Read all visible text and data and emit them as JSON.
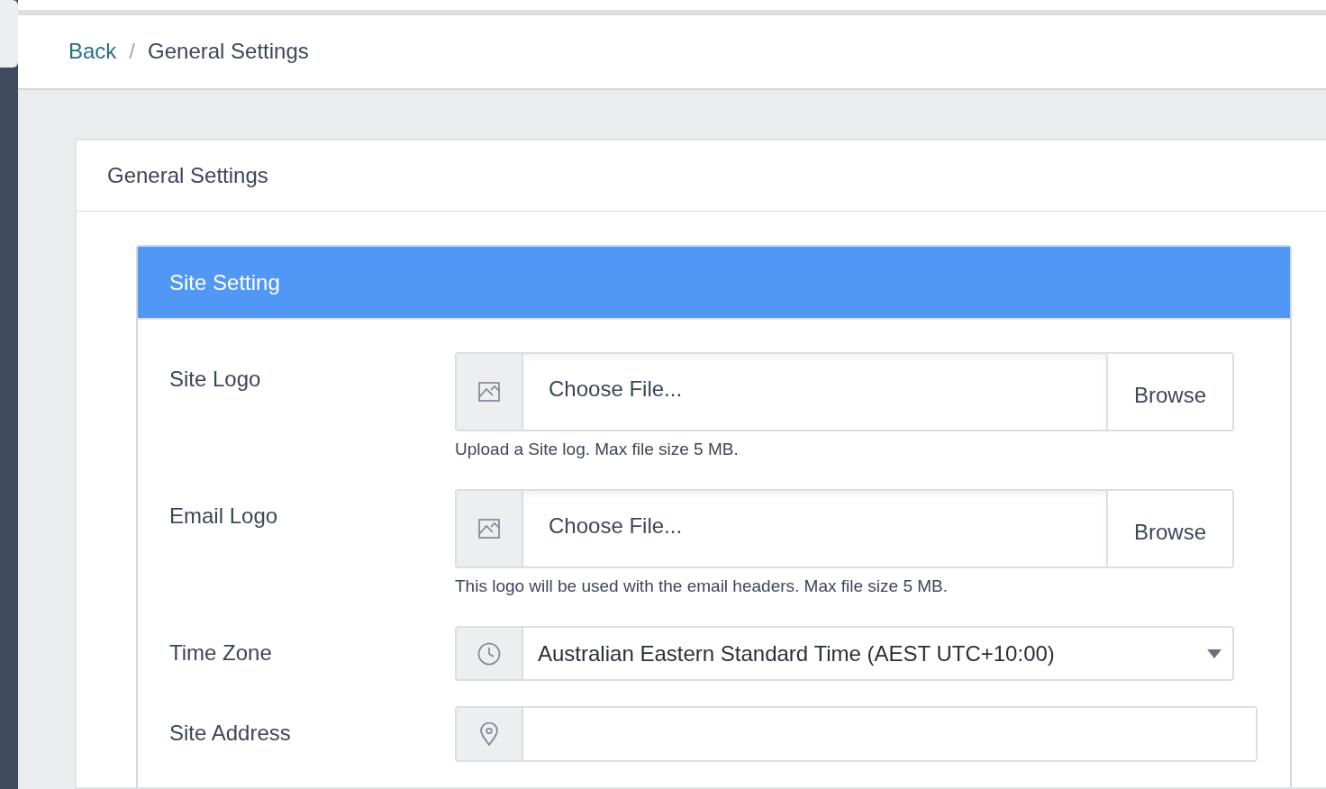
{
  "breadcrumb": [
    {
      "label": "Back",
      "kind": "link"
    },
    {
      "label": "General Settings",
      "kind": "current"
    }
  ],
  "breadcrumb_separator": "/",
  "card": {
    "title": "General Settings"
  },
  "panel": {
    "title": "Site Setting"
  },
  "fields": [
    {
      "label": "Site Logo",
      "kind": "file",
      "placeholder": "Choose File...",
      "button": "Browse",
      "help": "Upload a Site log. Max file size 5 MB."
    },
    {
      "label": "Email Logo",
      "kind": "file",
      "placeholder": "Choose File...",
      "button": "Browse",
      "help": "This logo will be used with the email headers. Max file size 5 MB."
    },
    {
      "label": "Time Zone",
      "kind": "select",
      "value": "Australian Eastern Standard Time (AEST UTC+10:00)"
    },
    {
      "label": "Site Address",
      "kind": "text"
    }
  ]
}
